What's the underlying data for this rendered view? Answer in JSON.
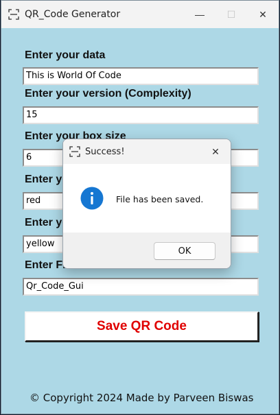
{
  "window": {
    "title": "QR_Code Generator",
    "controls": {
      "minimize": "—",
      "maximize": "☐",
      "close": "✕"
    }
  },
  "form": {
    "data_label": "Enter your data",
    "data_value": "This is World Of Code",
    "version_label": "Enter your version (Complexity)",
    "version_value": "15",
    "box_label": "Enter your box size",
    "box_value": "6",
    "fill_label": "Enter your fill color",
    "fill_value": "red",
    "back_label": "Enter your back color",
    "back_value": "yellow",
    "file_label": "Enter File Name",
    "file_value": "Qr_Code_Gui"
  },
  "save_button": "Save QR Code",
  "footer": "© Copyright 2024 Made by Parveen Biswas",
  "dialog": {
    "title": "Success!",
    "message": "File has been saved.",
    "ok_label": "OK",
    "close": "✕"
  },
  "colors": {
    "background": "#add8e6",
    "save_text": "#e00000",
    "info_icon": "#1677d2"
  }
}
